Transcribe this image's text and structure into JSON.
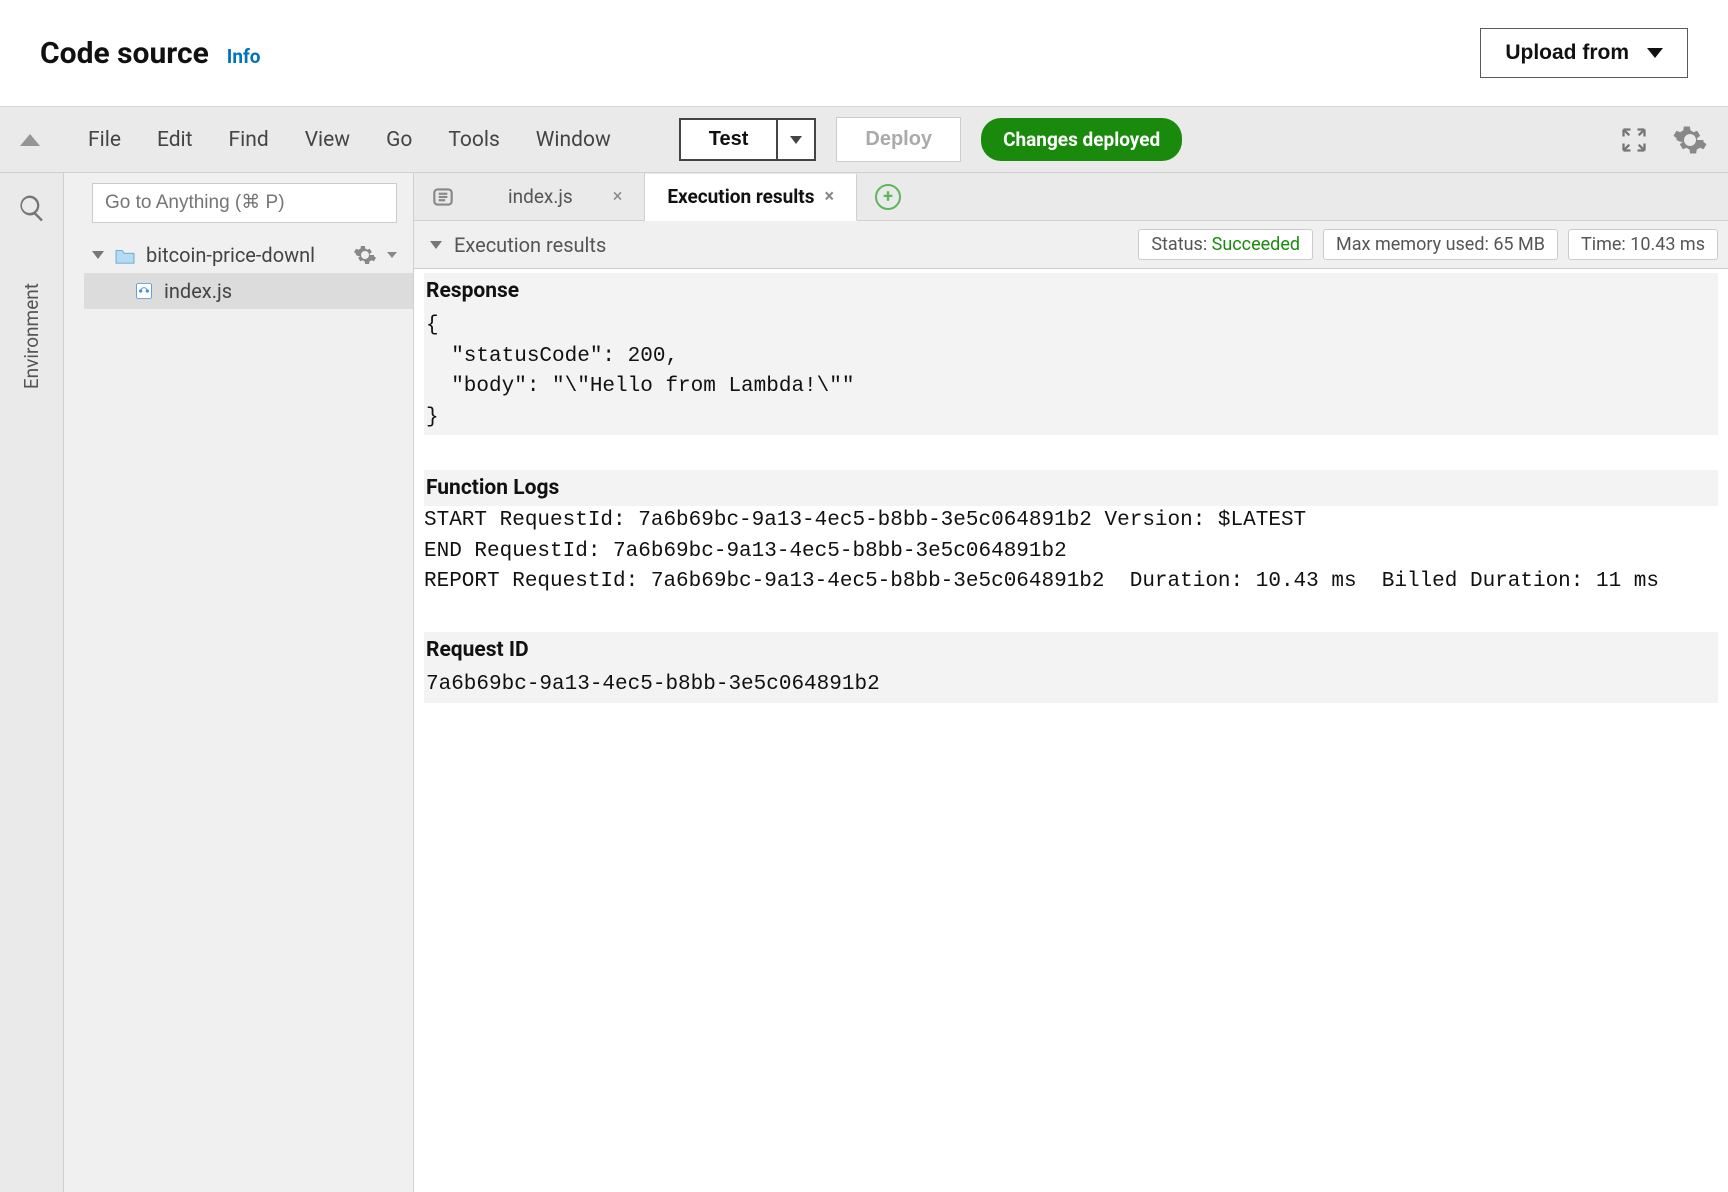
{
  "header": {
    "title": "Code source",
    "info": "Info",
    "upload": "Upload from"
  },
  "menu": {
    "file": "File",
    "edit": "Edit",
    "find": "Find",
    "view": "View",
    "go": "Go",
    "tools": "Tools",
    "window": "Window"
  },
  "toolbar": {
    "test": "Test",
    "deploy": "Deploy",
    "status": "Changes deployed"
  },
  "leftRail": {
    "environment": "Environment"
  },
  "sidebar": {
    "goto_placeholder": "Go to Anything (⌘ P)",
    "folder": "bitcoin-price-downlo",
    "file": "index.js"
  },
  "tabs": {
    "t1": "index.js",
    "t2": "Execution results"
  },
  "results": {
    "header": "Execution results",
    "status_label": "Status: ",
    "status_value": "Succeeded",
    "mem_label": "Max memory used: ",
    "mem_value": "65 MB",
    "time_label": "Time: ",
    "time_value": "10.43 ms",
    "response_title": "Response",
    "response_body": "{\n  \"statusCode\": 200,\n  \"body\": \"\\\"Hello from Lambda!\\\"\"\n}",
    "logs_title": "Function Logs",
    "logs_body": "START RequestId: 7a6b69bc-9a13-4ec5-b8bb-3e5c064891b2 Version: $LATEST\nEND RequestId: 7a6b69bc-9a13-4ec5-b8bb-3e5c064891b2\nREPORT RequestId: 7a6b69bc-9a13-4ec5-b8bb-3e5c064891b2  Duration: 10.43 ms  Billed Duration: 11 ms  ",
    "reqid_title": "Request ID",
    "reqid_value": "7a6b69bc-9a13-4ec5-b8bb-3e5c064891b2"
  }
}
